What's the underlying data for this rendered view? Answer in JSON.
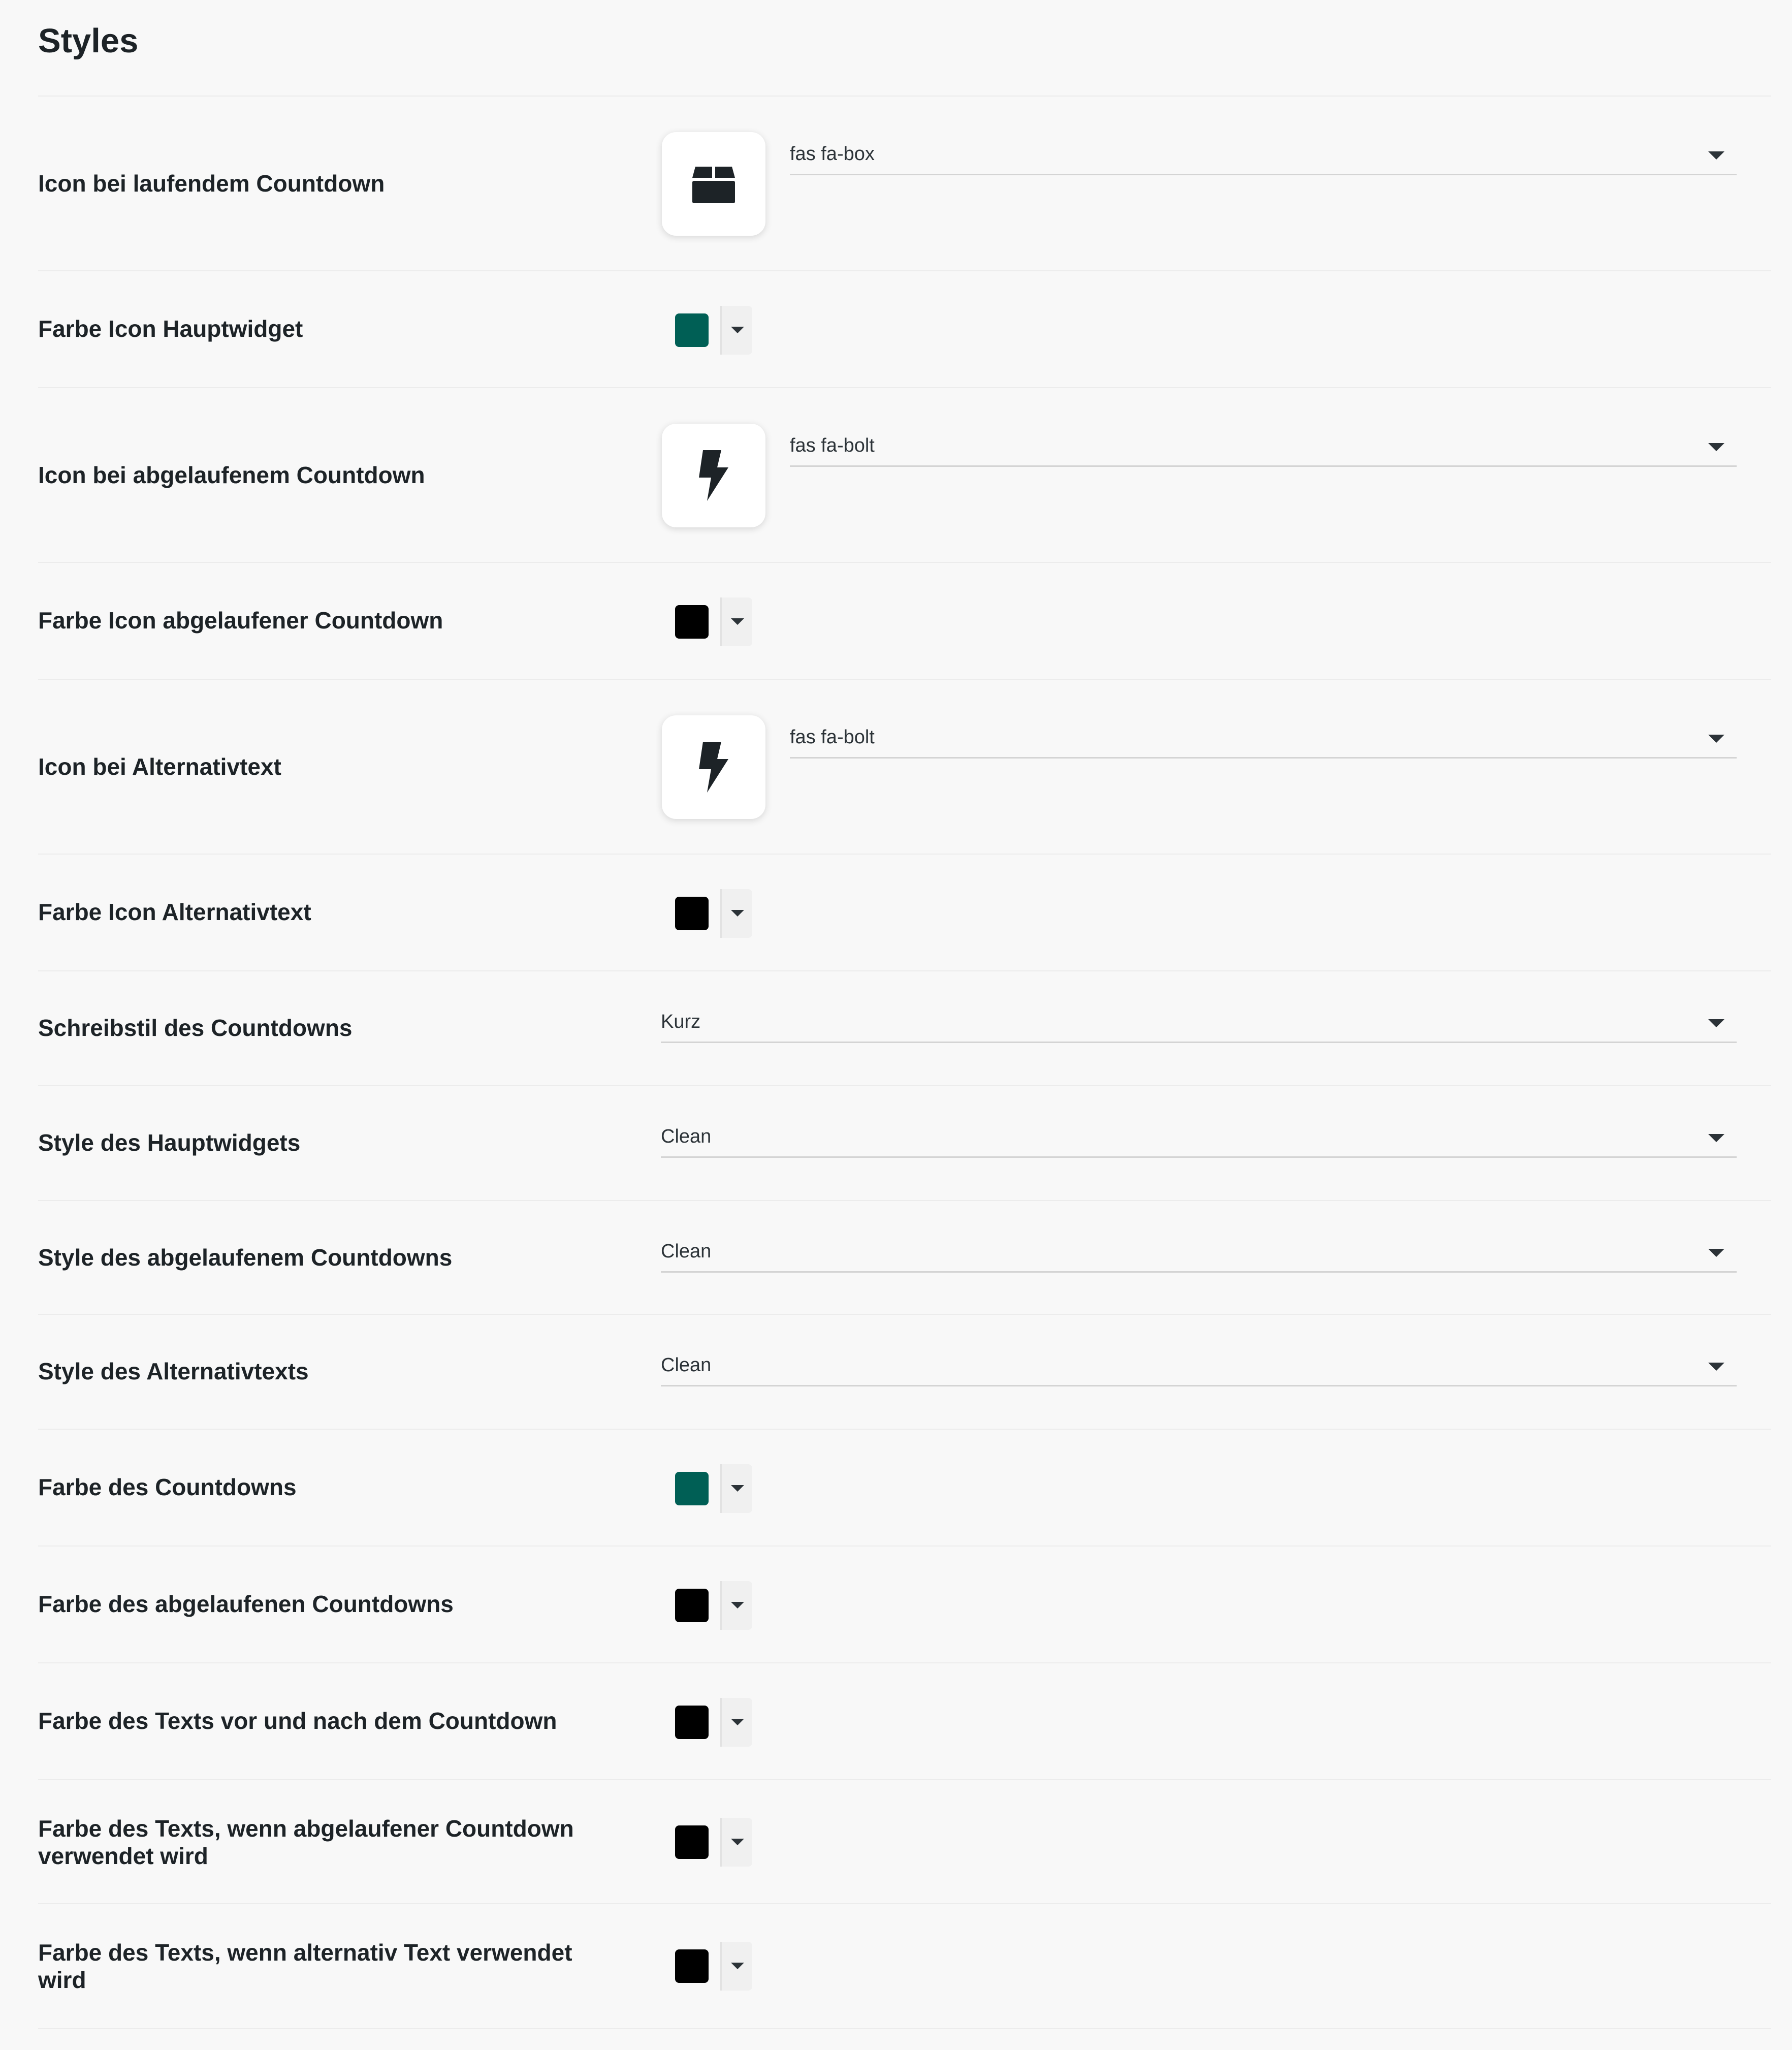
{
  "section": {
    "title": "Styles"
  },
  "rows": {
    "icon_running": {
      "label": "Icon bei laufendem Countdown",
      "icon": "box-icon",
      "value": "fas fa-box"
    },
    "color_icon_main": {
      "label": "Farbe Icon Hauptwidget",
      "color": "#005f55"
    },
    "icon_expired": {
      "label": "Icon bei abgelaufenem Countdown",
      "icon": "bolt-icon",
      "value": "fas fa-bolt"
    },
    "color_icon_expired": {
      "label": "Farbe Icon abgelaufener Countdown",
      "color": "#000000"
    },
    "icon_alt": {
      "label": "Icon bei Alternativtext",
      "icon": "bolt-icon",
      "value": "fas fa-bolt"
    },
    "color_icon_alt": {
      "label": "Farbe Icon Alternativtext",
      "color": "#000000"
    },
    "writing_style": {
      "label": "Schreibstil des Countdowns",
      "value": "Kurz"
    },
    "style_main": {
      "label": "Style des Hauptwidgets",
      "value": "Clean"
    },
    "style_expired": {
      "label": "Style des abgelaufenem Countdowns",
      "value": "Clean"
    },
    "style_alt": {
      "label": "Style des Alternativtexts",
      "value": "Clean"
    },
    "color_countdown": {
      "label": "Farbe des Countdowns",
      "color": "#005f55"
    },
    "color_countdown_expired": {
      "label": "Farbe des abgelaufenen Countdowns",
      "color": "#000000"
    },
    "color_text_before_after": {
      "label": "Farbe des Texts vor und nach dem Countdown",
      "color": "#000000"
    },
    "color_text_expired": {
      "label": "Farbe des Texts, wenn abgelaufener Countdown verwendet wird",
      "color": "#000000"
    },
    "color_text_alt": {
      "label": "Farbe des Texts, wenn alternativ Text verwendet wird",
      "color": "#000000"
    }
  }
}
